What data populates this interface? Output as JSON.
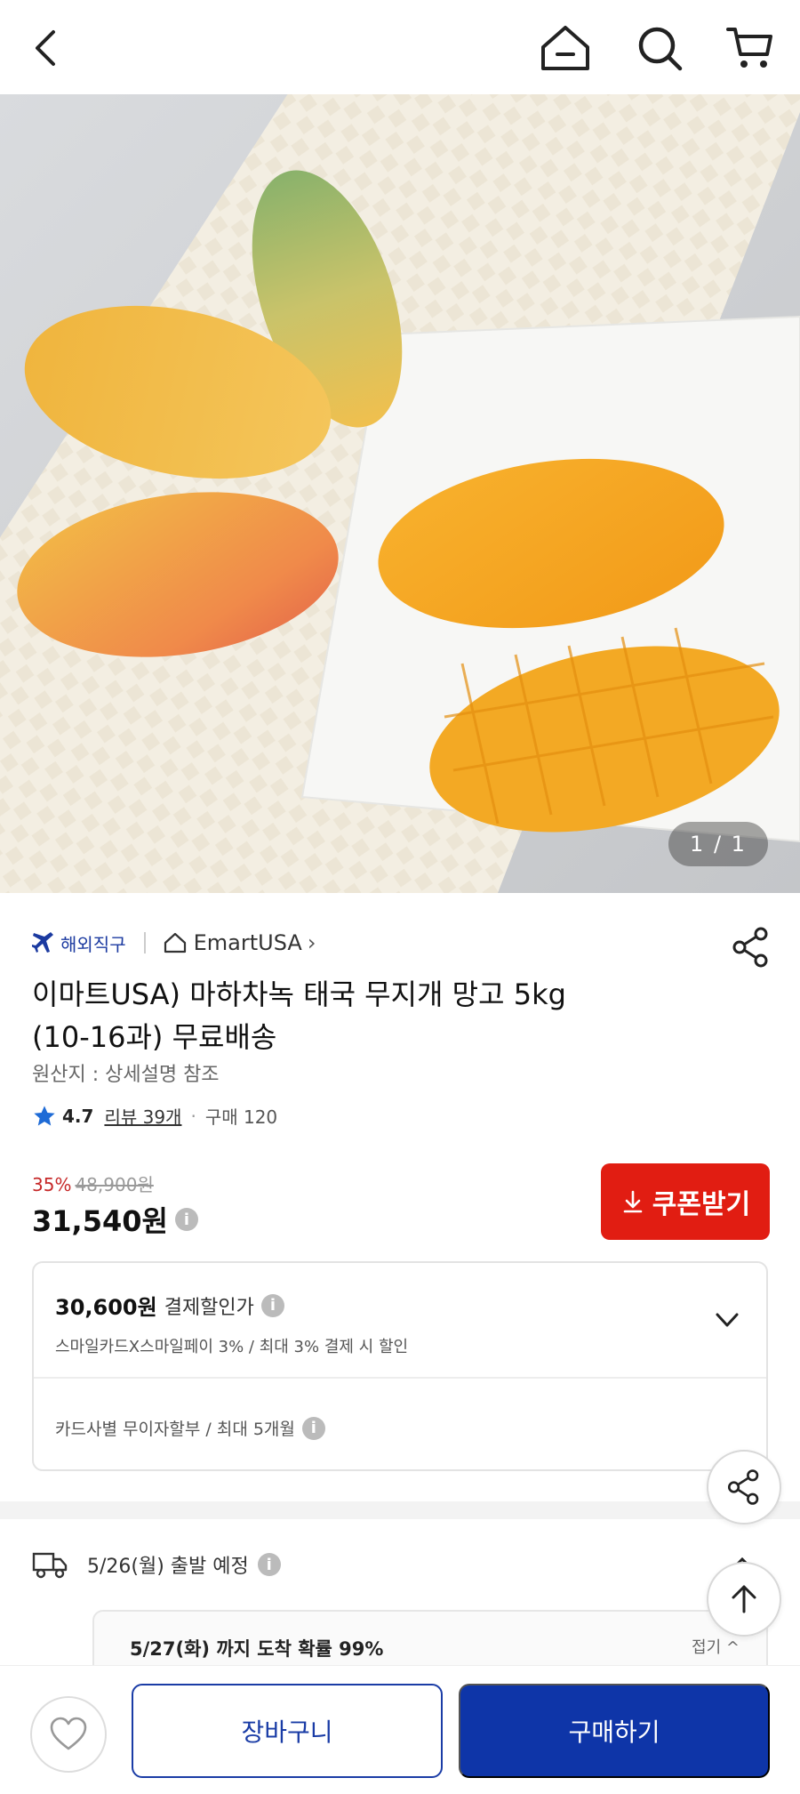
{
  "topbar": {
    "icons": [
      "back-arrow-icon",
      "home-icon",
      "search-icon",
      "cart-icon"
    ]
  },
  "hero": {
    "pager": "1 / 1"
  },
  "product": {
    "badge_label": "해외직구",
    "store_name": "EmartUSA",
    "title_line1": "이마트USA) 마하차녹 태국 무지개 망고 5kg",
    "title_line2": "(10-16과) 무료배송",
    "origin": "원산지 : 상세설명 참조",
    "rating": "4.7",
    "reviews": "리뷰 39개",
    "purchases": "구매 120",
    "discount_pct": "35%",
    "original_price": "48,900원",
    "price": "31,540원"
  },
  "coupon": {
    "label": "쿠폰받기"
  },
  "payment": {
    "discount_price": "30,600원",
    "discount_label": "결제할인가",
    "discount_detail": "스마일카드X스마일페이 3% / 최대 3% 결제 시 할인",
    "installment": "카드사별 무이자할부 / 최대 5개월"
  },
  "shipping": {
    "departure": "5/26(월) 출발 예정",
    "arrival": "5/27(화) 까지 도착 확률 99%",
    "fold": "접기"
  },
  "bottom": {
    "cart_label": "장바구니",
    "buy_label": "구매하기"
  },
  "colors": {
    "accent_red": "#e11d12",
    "brand_blue": "#0e35a8"
  }
}
